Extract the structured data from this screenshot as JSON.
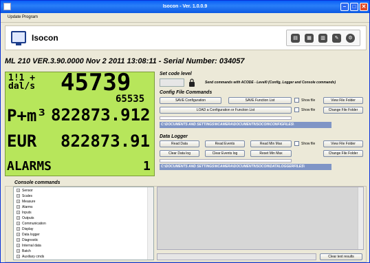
{
  "window": {
    "title": "Isocon - Ver. 1.0.0.9"
  },
  "menu": {
    "items": [
      "Update Program"
    ]
  },
  "header": {
    "app_name": "Isocon",
    "toolbar_icons": [
      "database-icon",
      "document-icon",
      "file-icon",
      "wrench-icon",
      "settings-icon"
    ]
  },
  "device": {
    "info": "ML 210 VER.3.90.0000 Nov  2 2011 13:08:11  -  Serial Number: 034057"
  },
  "lcd": {
    "unit_top": "1!1 +",
    "unit_bottom": "dal/s",
    "flow_value": "45739",
    "sub_value": "65535",
    "volume_label": "P+m³",
    "volume_value": "822873.912",
    "currency_label": "EUR",
    "currency_value": "822873.91",
    "alarms_label": "ALARMS",
    "alarms_count": "1"
  },
  "set_code": {
    "title": "Set code level",
    "value": "",
    "hint": "Send commands with ACODE - Level0  (Config, Logger and Console commands)"
  },
  "config": {
    "title": "Config File Commands",
    "save_config": "SAVE Configuration",
    "save_function": "SAVE Function List",
    "load": "LOAD a Configuration or Function List",
    "show_file": "Show file",
    "view_folder": "View File Folder",
    "change_folder": "Change File Folder",
    "path": "C:\\DOCUMENTS AND SETTINGS\\NCAMERA\\DOCUMENTI\\ISOCON\\CONFIGFILES\\"
  },
  "logger": {
    "title": "Data Logger",
    "read_data": "Read Data",
    "read_events": "Read Events",
    "read_minmax": "Read Min Max",
    "clear_data": "Clear Data log",
    "clear_events": "Clear Events log",
    "reset_minmax": "Reset Min Max",
    "show_file": "Show file",
    "view_folder": "View File Folder",
    "change_folder": "Change File Folder",
    "path": "C:\\DOCUMENTS AND SETTINGS\\NCAMERA\\DOCUMENTI\\ISOCON\\DATALOGGERFILES\\"
  },
  "console": {
    "title": "Console commands",
    "tree": [
      "Sensor",
      "Scales",
      "Measure",
      "Alarms",
      "Inputs",
      "Outputs",
      "Communication",
      "Display",
      "Data logger",
      "Diagnostic",
      "Internal data",
      "Batch",
      "Auxiliary cmds"
    ],
    "clear_results": "Clear text results"
  }
}
